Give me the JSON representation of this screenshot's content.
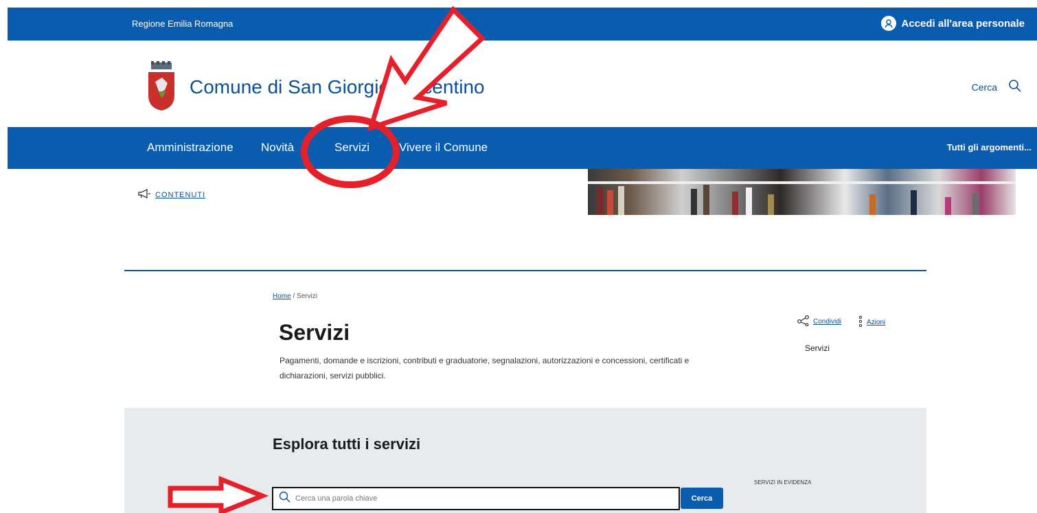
{
  "topbar": {
    "region": "Regione Emilia Romagna",
    "login_label": "Accedi all'area personale"
  },
  "header": {
    "site_title": "Comune di San Giorgio Piacentino",
    "search_label": "Cerca",
    "search_icon": "search-icon",
    "logo_icon": "coat-of-arms-icon"
  },
  "nav": {
    "items": [
      {
        "label": "Amministrazione"
      },
      {
        "label": "Novità"
      },
      {
        "label": "Servizi"
      },
      {
        "label": "Vivere il Comune"
      }
    ],
    "topics_label": "Tutti gli argomenti..."
  },
  "content_tag": {
    "label": "CONTENUTI",
    "icon": "megaphone-icon"
  },
  "breadcrumb": {
    "home": "Home",
    "separator": "/",
    "current": "Servizi"
  },
  "page": {
    "title": "Servizi",
    "description": "Pagamenti, domande e iscrizioni, contributi e graduatorie, segnalazioni, autorizzazioni e concessioni, certificati e dichiarazioni, servizi pubblici."
  },
  "page_actions": {
    "share_label": "Condividi",
    "actions_label": "Azioni",
    "side_title": "Servizi"
  },
  "explore": {
    "title": "Esplora tutti i servizi",
    "search_placeholder": "Cerca una parola chiave",
    "search_button": "Cerca",
    "featured_label": "SERVIZI IN EVIDENZA"
  },
  "colors": {
    "brand_blue": "#0a5cae",
    "annotation_red": "#e5202a",
    "explore_bg": "#e8ebee"
  }
}
